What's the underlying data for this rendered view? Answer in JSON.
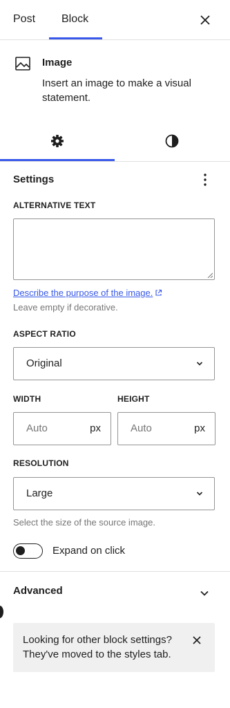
{
  "header": {
    "tabs": [
      {
        "label": "Post",
        "active": false
      },
      {
        "label": "Block",
        "active": true
      }
    ],
    "close_icon": "close-icon"
  },
  "block": {
    "icon": "image-icon",
    "title": "Image",
    "description": "Insert an image to make a visual statement."
  },
  "inspector_tabs": [
    {
      "name": "settings",
      "icon": "gear-icon",
      "active": true
    },
    {
      "name": "styles",
      "icon": "contrast-icon",
      "active": false
    }
  ],
  "settings": {
    "title": "Settings",
    "menu_icon": "more-vertical-icon",
    "alt_text": {
      "label": "ALTERNATIVE TEXT",
      "value": "",
      "help_link": "Describe the purpose of the image.",
      "help_text": "Leave empty if decorative."
    },
    "aspect_ratio": {
      "label": "ASPECT RATIO",
      "value": "Original"
    },
    "width": {
      "label": "WIDTH",
      "placeholder": "Auto",
      "unit": "px"
    },
    "height": {
      "label": "HEIGHT",
      "placeholder": "Auto",
      "unit": "px"
    },
    "resolution": {
      "label": "RESOLUTION",
      "value": "Large",
      "help_text": "Select the size of the source image."
    },
    "expand_on_click": {
      "label": "Expand on click",
      "checked": false
    }
  },
  "advanced": {
    "title": "Advanced",
    "expanded": false
  },
  "notice": {
    "text": "Looking for other block settings? They've moved to the styles tab."
  },
  "colors": {
    "accent": "#3858e9",
    "text": "#1e1e1e",
    "muted": "#757575",
    "border": "#949494",
    "notice_bg": "#f0f0f0"
  }
}
